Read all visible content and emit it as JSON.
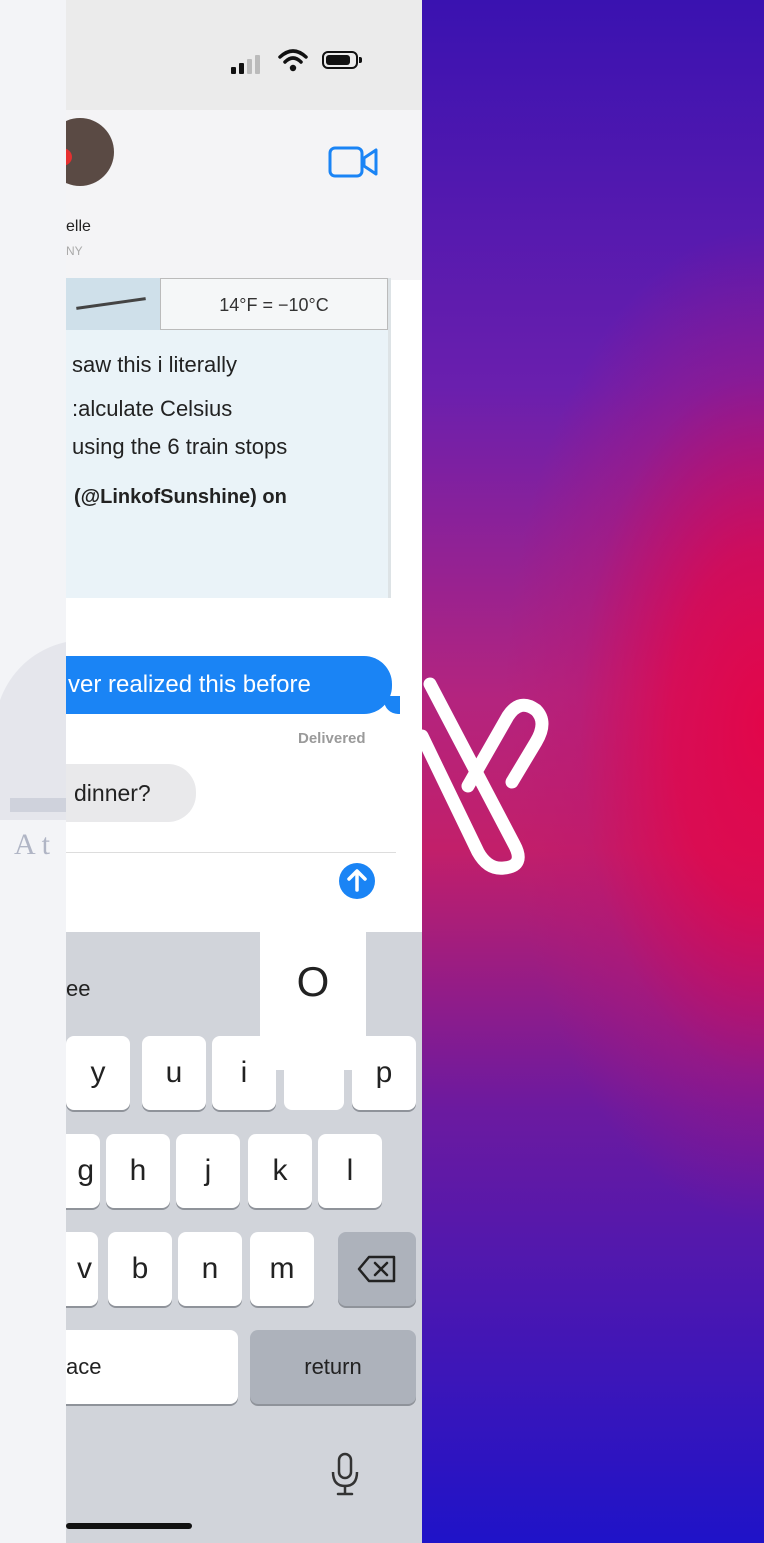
{
  "status_bar": {
    "icons": [
      "signal-icon",
      "wifi-icon",
      "battery-icon"
    ]
  },
  "header": {
    "contact_name": "elle",
    "contact_location": "NY",
    "video_icon": "video-camera-icon"
  },
  "link_card": {
    "conversion": "14°F = −10°C",
    "lines": [
      "saw this i literally",
      ":alculate Celsius",
      "using the 6 train stops"
    ],
    "byline": "(@LinkofSunshine) on"
  },
  "messages": {
    "sent_text": "ver realized this before",
    "delivered": "Delivered",
    "received_text": "dinner?"
  },
  "keyboard": {
    "suggestion": "ee",
    "popup_key": "O",
    "row1": [
      "y",
      "u",
      "i",
      "p"
    ],
    "row2": [
      "g",
      "h",
      "j",
      "k",
      "l"
    ],
    "row3": [
      "v",
      "b",
      "n",
      "m"
    ],
    "space": "ace",
    "return": "return"
  },
  "watermark": {
    "text": "At"
  },
  "colors": {
    "imessage_blue": "#1a84f5",
    "gradient_top": "#3a12b0",
    "gradient_mid": "#e2064a",
    "gradient_bottom": "#1f13c8"
  }
}
